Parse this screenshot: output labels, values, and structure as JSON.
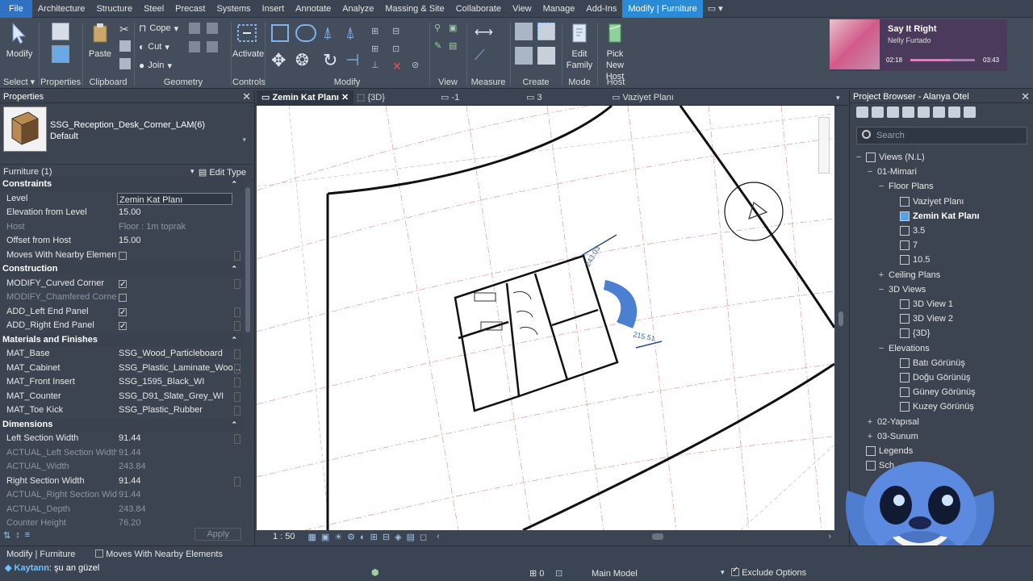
{
  "menu": {
    "tabs": [
      "File",
      "Architecture",
      "Structure",
      "Steel",
      "Precast",
      "Systems",
      "Insert",
      "Annotate",
      "Analyze",
      "Massing & Site",
      "Collaborate",
      "View",
      "Manage",
      "Add-Ins",
      "Modify | Furniture"
    ]
  },
  "ribbon": {
    "modify_label": "Modify",
    "select_label": "Select",
    "properties_label": "Properties",
    "paste_label": "Paste",
    "clipboard_label": "Clipboard",
    "cope_label": "Cope",
    "cut_label": "Cut",
    "join_label": "Join",
    "geometry_label": "Geometry",
    "activate_label": "Activate",
    "controls_label": "Controls",
    "modify_group_label": "Modify",
    "view_label": "View",
    "measure_label": "Measure",
    "create_label": "Create",
    "edit_family_label_1": "Edit",
    "edit_family_label_2": "Family",
    "mode_label": "Mode",
    "pick_host_label_1": "Pick",
    "pick_host_label_2": "New Host",
    "host_label": "Host"
  },
  "music": {
    "title": "Say It Right",
    "artist": "Nelly Furtado",
    "elapsed": "02:18",
    "total": "03:43",
    "progress": 0.62
  },
  "properties": {
    "title": "Properties",
    "type_name": "SSG_Reception_Desk_Corner_LAM(6)",
    "type_sub": "Default",
    "filter": "Furniture (1)",
    "edit_type": "Edit Type",
    "apply": "Apply",
    "rows": [
      {
        "kind": "sec",
        "k": "Constraints"
      },
      {
        "kind": "row",
        "k": "Level",
        "v": "Zemin Kat Planı",
        "box": true
      },
      {
        "kind": "row",
        "k": "Elevation from Level",
        "v": "15.00"
      },
      {
        "kind": "dim",
        "k": "Host",
        "v": "Floor : 1m toprak"
      },
      {
        "kind": "row",
        "k": "Offset from Host",
        "v": "15.00"
      },
      {
        "kind": "row",
        "k": "Moves With Nearby Elements",
        "v": "",
        "cb": false
      },
      {
        "kind": "sec",
        "k": "Construction"
      },
      {
        "kind": "row",
        "k": "MODIFY_Curved Corner",
        "v": "",
        "cb": true
      },
      {
        "kind": "dim",
        "k": "MODIFY_Chamfered Corner",
        "v": "",
        "cb": false
      },
      {
        "kind": "row",
        "k": "ADD_Left End Panel",
        "v": "",
        "cb": true
      },
      {
        "kind": "row",
        "k": "ADD_Right End Panel",
        "v": "",
        "cb": true
      },
      {
        "kind": "sec",
        "k": "Materials and Finishes"
      },
      {
        "kind": "row",
        "k": "MAT_Base",
        "v": "SSG_Wood_Particleboard"
      },
      {
        "kind": "row",
        "k": "MAT_Cabinet",
        "v": "SSG_Plastic_Laminate_Woo..."
      },
      {
        "kind": "row",
        "k": "MAT_Front Insert",
        "v": "SSG_1595_Black_WI"
      },
      {
        "kind": "row",
        "k": "MAT_Counter",
        "v": "SSG_D91_Slate_Grey_WI"
      },
      {
        "kind": "row",
        "k": "MAT_Toe Kick",
        "v": "SSG_Plastic_Rubber"
      },
      {
        "kind": "sec",
        "k": "Dimensions"
      },
      {
        "kind": "row",
        "k": "Left Section Width",
        "v": "91.44"
      },
      {
        "kind": "dim",
        "k": "ACTUAL_Left Section Width",
        "v": "91.44"
      },
      {
        "kind": "dim",
        "k": "ACTUAL_Width",
        "v": "243.84"
      },
      {
        "kind": "row",
        "k": "Right Section Width",
        "v": "91.44"
      },
      {
        "kind": "dim",
        "k": "ACTUAL_Right Section Width",
        "v": "91.44"
      },
      {
        "kind": "dim",
        "k": "ACTUAL_Depth",
        "v": "243.84"
      },
      {
        "kind": "dim",
        "k": "Counter Height",
        "v": "76.20"
      }
    ]
  },
  "view_tabs": {
    "t1": "Zemin Kat Planı",
    "t2": "{3D}",
    "t3": "-1",
    "t4": "3",
    "t5": "Vaziyet Planı"
  },
  "canvas": {
    "dim1": "215.51",
    "dim2": "243.03"
  },
  "viewbar": {
    "scale": "1 : 50"
  },
  "browser": {
    "title": "Project Browser - Alanya Otel",
    "search_placeholder": "Search",
    "nodes": [
      {
        "label": "Views (N.L)",
        "level": 0,
        "tw": "−",
        "icon": true
      },
      {
        "label": "01-Mimari",
        "level": 1,
        "tw": "−"
      },
      {
        "label": "Floor Plans",
        "level": 2,
        "tw": "−"
      },
      {
        "label": "Vaziyet Planı",
        "level": 3,
        "icon": true
      },
      {
        "label": "Zemin Kat Planı",
        "level": 3,
        "icon": true,
        "sel": true
      },
      {
        "label": "3.5",
        "level": 3,
        "icon": true
      },
      {
        "label": "7",
        "level": 3,
        "icon": true
      },
      {
        "label": "10.5",
        "level": 3,
        "icon": true
      },
      {
        "label": "Ceiling Plans",
        "level": 2,
        "tw": "+"
      },
      {
        "label": "3D Views",
        "level": 2,
        "tw": "−"
      },
      {
        "label": "3D View 1",
        "level": 3,
        "icon": true
      },
      {
        "label": "3D View 2",
        "level": 3,
        "icon": true
      },
      {
        "label": "{3D}",
        "level": 3,
        "icon": true
      },
      {
        "label": "Elevations",
        "level": 2,
        "tw": "−"
      },
      {
        "label": "Batı Görünüş",
        "level": 3,
        "icon": true
      },
      {
        "label": "Doğu Görünüş",
        "level": 3,
        "icon": true
      },
      {
        "label": "Güney Görünüş",
        "level": 3,
        "icon": true
      },
      {
        "label": "Kuzey Görünüş",
        "level": 3,
        "icon": true
      },
      {
        "label": "02-Yapısal",
        "level": 1,
        "tw": "+"
      },
      {
        "label": "03-Sunum",
        "level": 1,
        "tw": "+"
      },
      {
        "label": "Legends",
        "level": 0,
        "icon": true
      },
      {
        "label": "Sch",
        "level": 0,
        "icon": true
      }
    ]
  },
  "status": {
    "mode": "Modify | Furniture",
    "moves": "Moves With Nearby Elements",
    "model": "Main Model",
    "exclude": "Exclude Options",
    "coord": "0",
    "chat_user": "Kaytann",
    "chat_msg": "şu an güzel"
  },
  "colors": {
    "accent": "#2a8bd6",
    "selection": "#4a7fd1"
  }
}
